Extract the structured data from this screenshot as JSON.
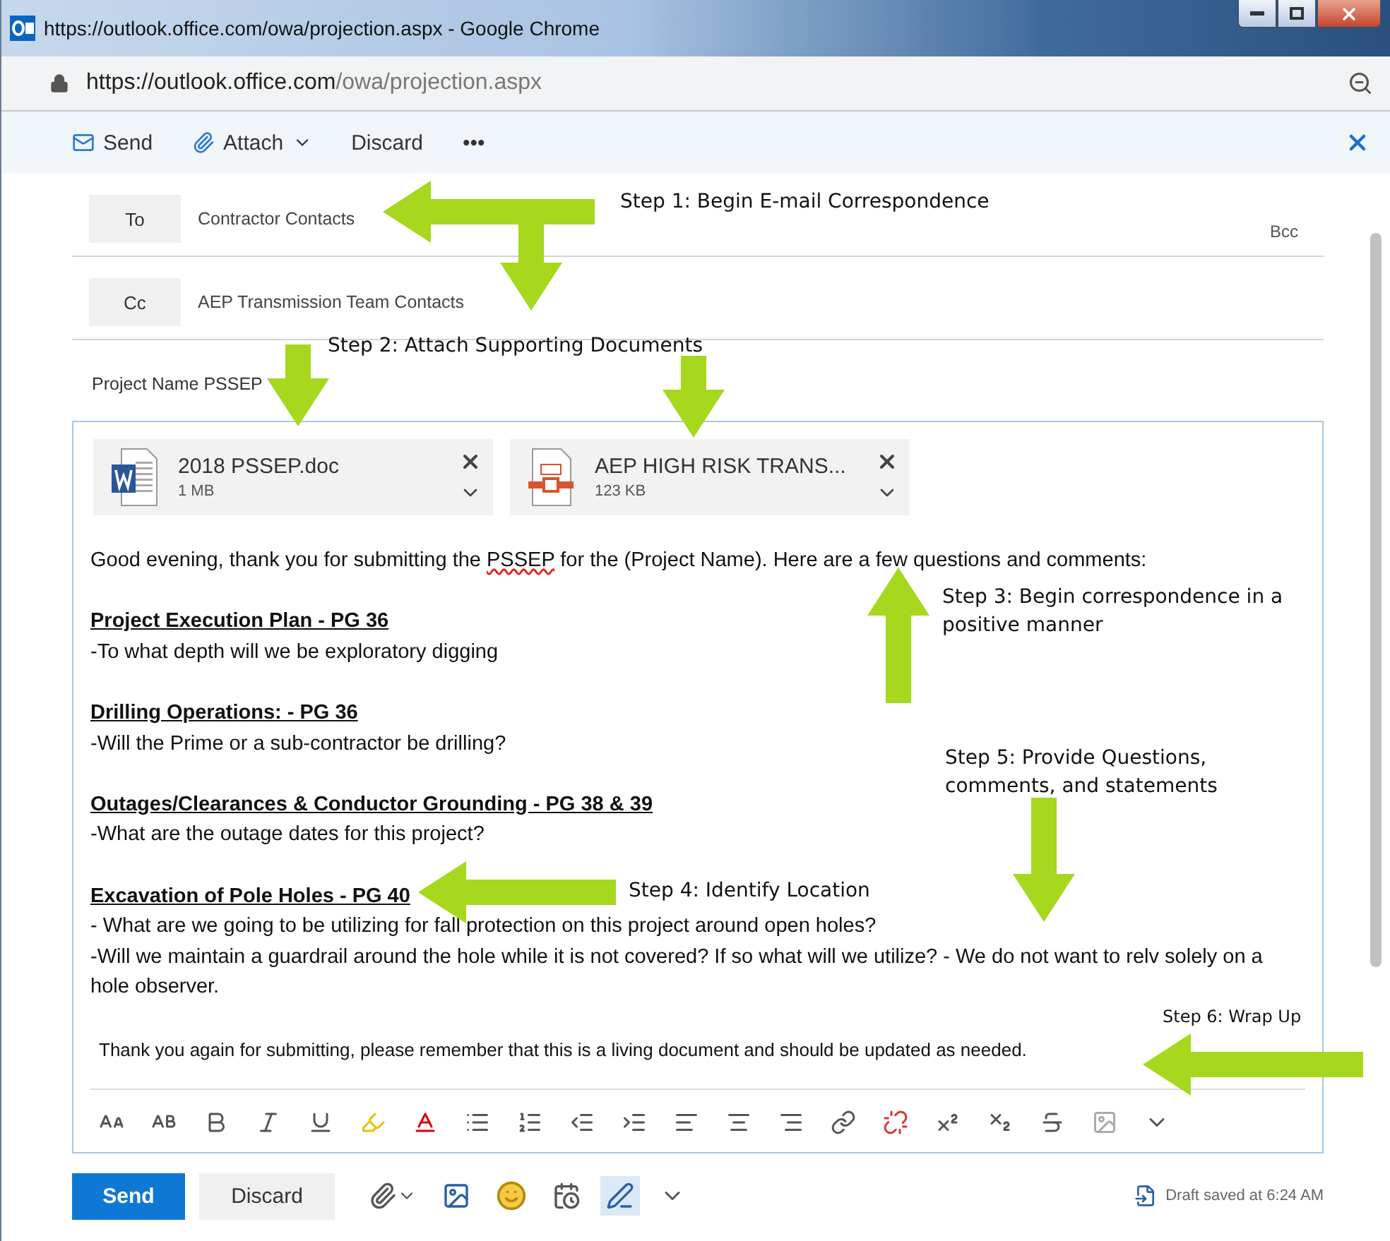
{
  "window": {
    "title": "https://outlook.office.com/owa/projection.aspx - Google Chrome"
  },
  "address_bar": {
    "url_host": "https://outlook.office.com",
    "url_path": "/owa/projection.aspx"
  },
  "toolbar": {
    "send": "Send",
    "attach": "Attach",
    "discard": "Discard",
    "more": "•••"
  },
  "recipients": [
    {
      "button": "To",
      "value": "Contractor Contacts"
    },
    {
      "button": "Cc",
      "value": "AEP Transmission Team Contacts"
    }
  ],
  "bcc": "Bcc",
  "subject": "Project Name PSSEP",
  "attachments": [
    {
      "kind": "word",
      "name": "2018 PSSEP.doc",
      "size": "1 MB"
    },
    {
      "kind": "pdf",
      "name": "AEP HIGH RISK TRANS...",
      "size": "123 KB"
    }
  ],
  "body": {
    "greeting": {
      "before": "Good evening, thank you for submitting the ",
      "flagged": "PSSEP",
      "after": " for the (Project Name). Here are a few questions and comments:"
    },
    "sections": [
      {
        "heading": "Project Execution Plan - PG 36",
        "lines": [
          "-To what depth will we be exploratory digging"
        ]
      },
      {
        "heading": "Drilling Operations: - PG 36",
        "lines": [
          "-Will the Prime or a sub-contractor be drilling?"
        ]
      },
      {
        "heading": "Outages/Clearances & Conductor Grounding - PG 38 & 39",
        "lines": [
          "-What are the outage dates for this project?"
        ]
      },
      {
        "heading": "Excavation of Pole Holes - PG 40",
        "lines": [
          "- What are we going to be utilizing for fall protection on this project around open holes?",
          "-Will we maintain a guardrail around the hole while it is not covered? If so what will we utilize? - We do not want to relv solely on a hole observer."
        ]
      }
    ],
    "closing": "Thank you again for submitting, please remember that this is a living document and should be updated as needed."
  },
  "footer": {
    "send": "Send",
    "discard": "Discard",
    "draft_status": "Draft saved at 6:24 AM"
  },
  "annotations": [
    "Step 1: Begin E-mail Correspondence",
    "Step 2: Attach Supporting Documents",
    "Step 3: Begin correspondence in a positive manner",
    "Step 4: Identify Location",
    "Step 5: Provide Questions, comments, and statements",
    "Step 6: Wrap Up"
  ]
}
